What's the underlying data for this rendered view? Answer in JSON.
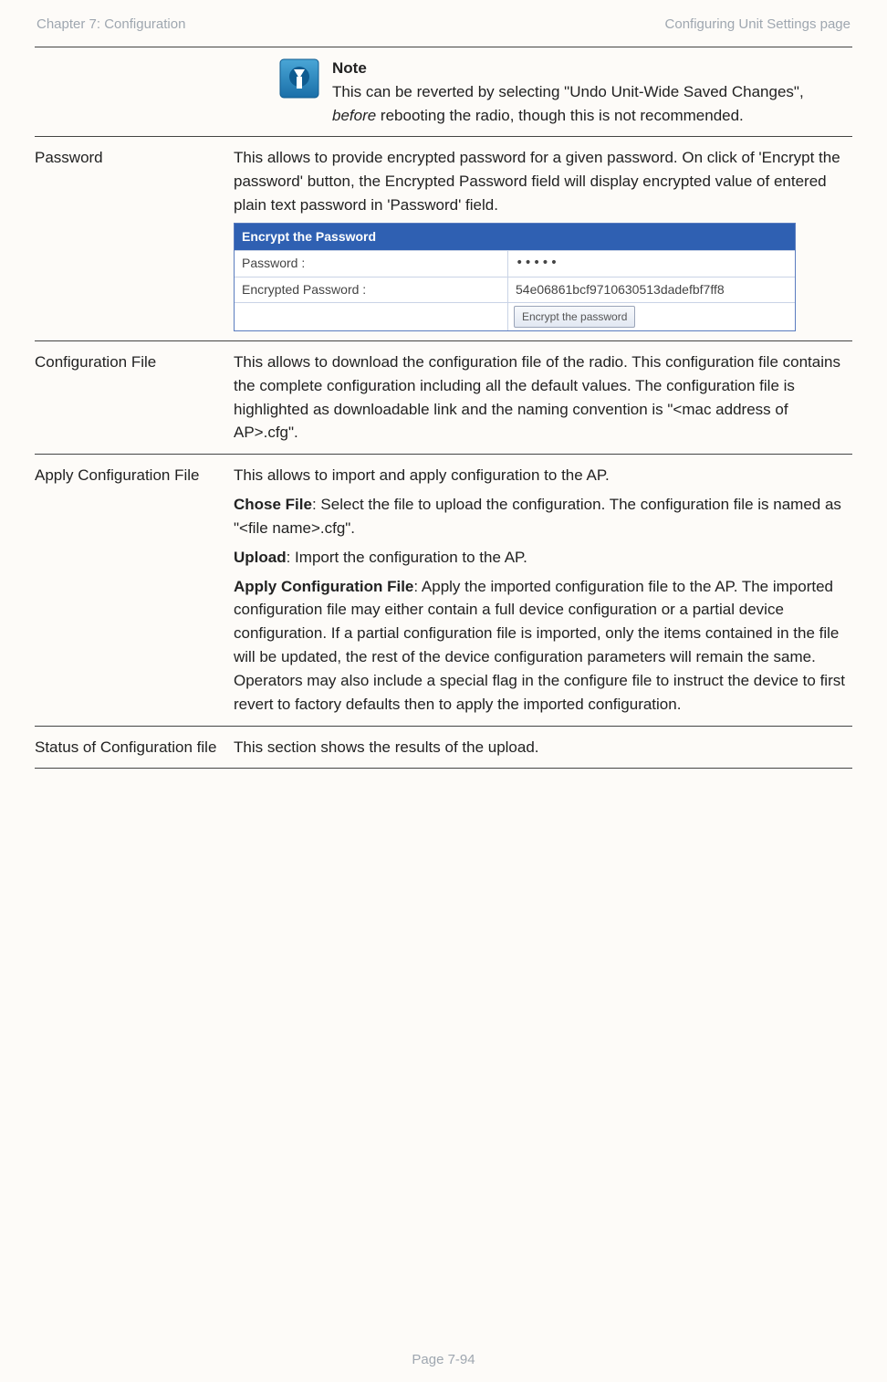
{
  "header": {
    "left": "Chapter 7:  Configuration",
    "right": "Configuring Unit Settings page"
  },
  "footer": {
    "pagenum": "Page 7-94"
  },
  "note": {
    "heading": "Note",
    "line1": "This can be reverted by selecting \"Undo Unit-Wide Saved Changes\", ",
    "before": "before",
    "line2": " rebooting the radio, though this is not recommended."
  },
  "rows": {
    "password": {
      "label": "Password",
      "desc": "This allows to provide encrypted password for a given password. On click of 'Encrypt the password' button, the Encrypted Password field will display encrypted value of entered plain text password in 'Password' field."
    },
    "configFile": {
      "label": "Configuration File",
      "desc": "This allows to download the configuration file of the radio. This configuration file contains the complete configuration including all the default values. The configuration file is highlighted as downloadable link and the naming convention is \"<mac address of AP>.cfg\"."
    },
    "applyConfig": {
      "label": "Apply Configuration File",
      "p1": "This allows to import and apply configuration to the AP.",
      "cfLabel": "Chose File",
      "cfText": ": Select the file to upload the configuration. The configuration file is named as \"<file name>.cfg\".",
      "uploadLabel": "Upload",
      "uploadText": ": Import the configuration to the AP.",
      "acfLabel": "Apply Configuration File",
      "acfText": ": Apply the imported configuration file to the AP. The imported configuration file may either contain a full device configuration or a partial device configuration. If a partial configuration file is imported, only the items contained in the file will be updated, the rest of the device configuration parameters will remain the same. Operators may also include a special flag in the configure file to instruct the device to first revert to factory defaults then to apply the imported configuration."
    },
    "status": {
      "label": "Status of Configuration file",
      "desc": "This section shows the results of the upload."
    }
  },
  "encrypt": {
    "title": "Encrypt the Password",
    "pwLabel": "Password :",
    "pwValue": "•••••",
    "epLabel": "Encrypted Password :",
    "epValue": "54e06861bcf9710630513dadefbf7ff8",
    "button": "Encrypt the password"
  }
}
